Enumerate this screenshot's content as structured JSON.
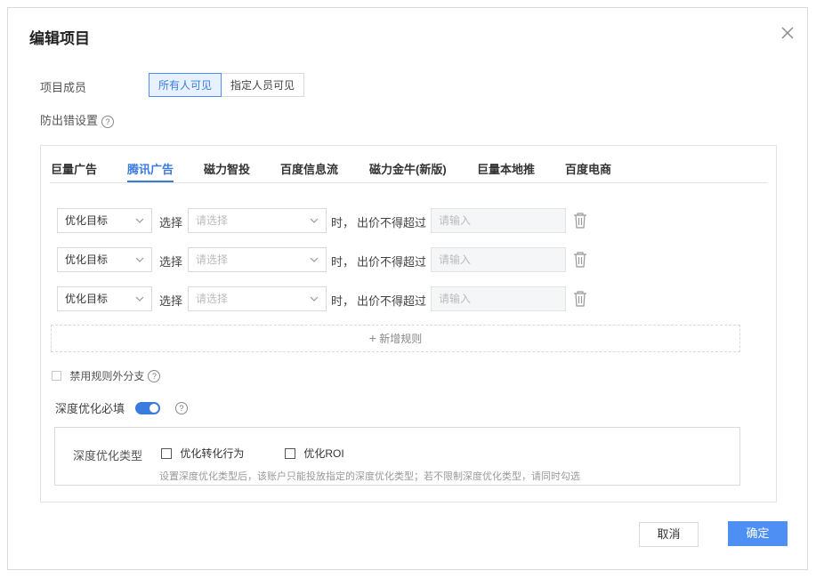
{
  "dialog": {
    "title": "编辑项目"
  },
  "members": {
    "label": "项目成员",
    "options": [
      "所有人可见",
      "指定人员可见"
    ],
    "selected": "所有人可见"
  },
  "anti_error": {
    "label": "防出错设置",
    "help_glyph": "?"
  },
  "tabs": [
    {
      "label": "巨量广告"
    },
    {
      "label": "腾讯广告",
      "active": true
    },
    {
      "label": "磁力智投"
    },
    {
      "label": "百度信息流"
    },
    {
      "label": "磁力金牛(新版)"
    },
    {
      "label": "巨量本地推"
    },
    {
      "label": "百度电商"
    }
  ],
  "rules": [
    {
      "target": "优化目标",
      "select_label": "选择",
      "select_placeholder": "请选择",
      "when_text": "时，",
      "limit_label": "出价不得超过",
      "input_placeholder": "请输入"
    },
    {
      "target": "优化目标",
      "select_label": "选择",
      "select_placeholder": "请选择",
      "when_text": "时，",
      "limit_label": "出价不得超过",
      "input_placeholder": "请输入"
    },
    {
      "target": "优化目标",
      "select_label": "选择",
      "select_placeholder": "请选择",
      "when_text": "时，",
      "limit_label": "出价不得超过",
      "input_placeholder": "请输入"
    }
  ],
  "add_rule": {
    "plus": "+",
    "label": "新增规则"
  },
  "disable_branch": {
    "label": "禁用规则外分支",
    "checked": false
  },
  "deep_opt": {
    "label": "深度优化必填",
    "enabled": true,
    "type_label": "深度优化类型",
    "options": [
      {
        "label": "优化转化行为",
        "checked": false
      },
      {
        "label": "优化ROI",
        "checked": false
      }
    ],
    "hint": "设置深度优化类型后，该账户只能投放指定的深度优化类型；若不限制深度优化类型，请同时勾选"
  },
  "footer": {
    "cancel_label": "取消",
    "ok_label": "确定"
  },
  "colors": {
    "accent": "#3a7be0",
    "primary_button": "#4d8ff2",
    "active_segment_bg": "#e8f1ff"
  },
  "icons": {
    "close": "close-icon",
    "trash": "trash-icon",
    "chevron": "chevron-down-icon",
    "help": "help-circle-icon"
  }
}
